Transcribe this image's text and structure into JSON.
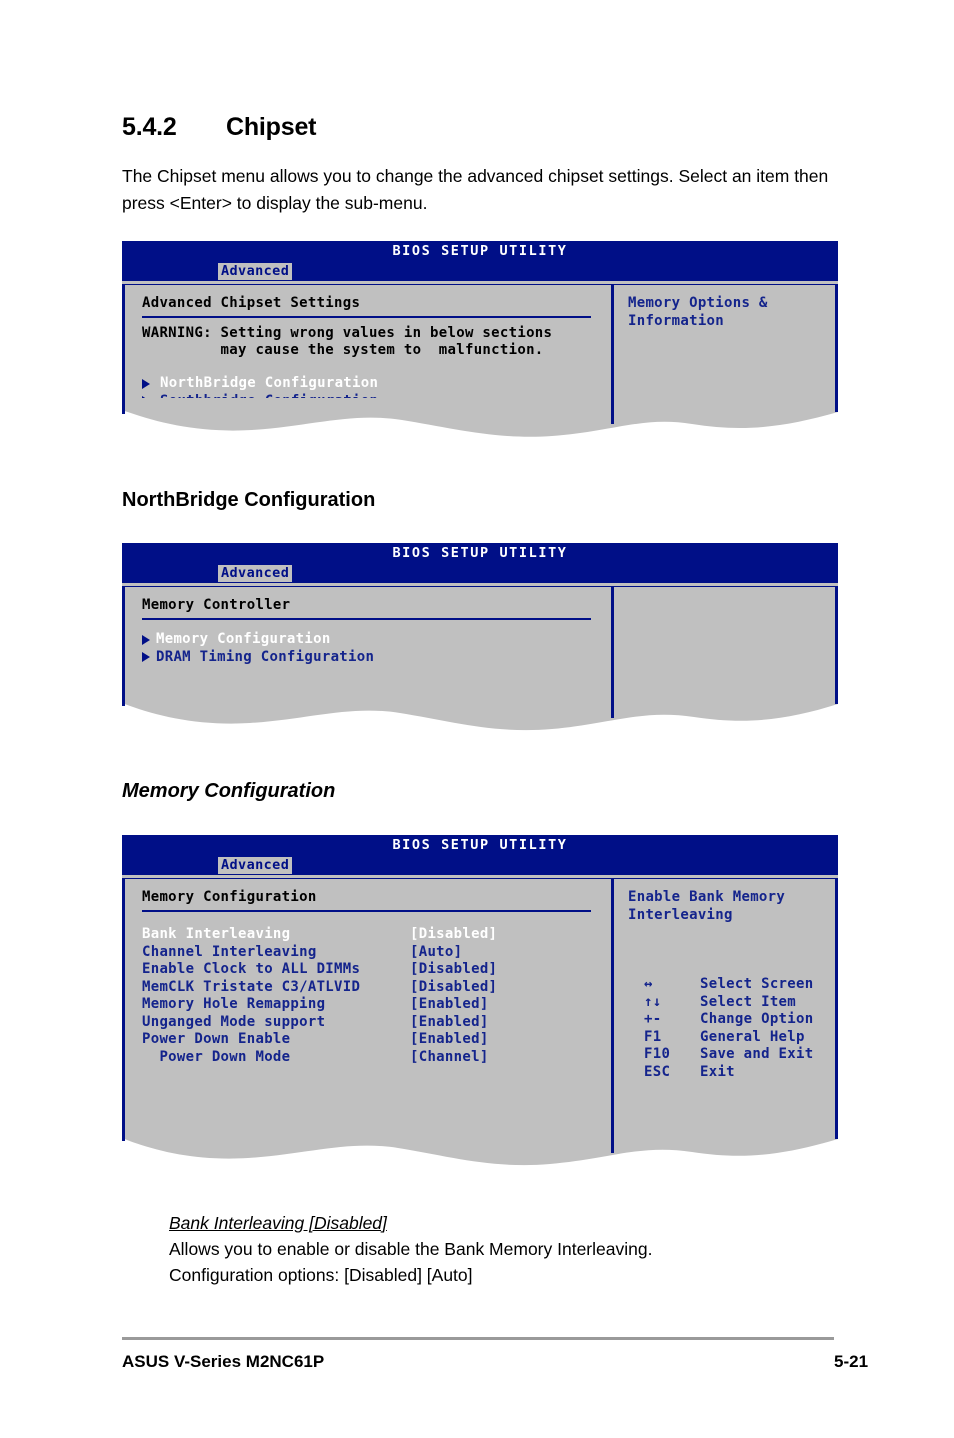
{
  "section": {
    "number": "5.4.2",
    "title": "Chipset",
    "intro": "The Chipset menu allows you to change the advanced chipset settings. Select an item then press <Enter> to display the sub-menu."
  },
  "subheadings": {
    "northbridge": "NorthBridge Configuration",
    "memory_configuration": "Memory Configuration"
  },
  "bios_common": {
    "title": "BIOS SETUP UTILITY",
    "tab": "Advanced"
  },
  "screen1": {
    "section_title": "Advanced Chipset Settings",
    "warning_line1": "WARNING: Setting wrong values in below sections",
    "warning_line2": "         may cause the system to  malfunction.",
    "menu": [
      {
        "label": "NorthBridge Configuration",
        "selected": true
      },
      {
        "label": "Southbridge Configuration",
        "selected": false
      }
    ],
    "help": "Memory Options &\nInformation"
  },
  "screen2": {
    "section_title": "Memory Controller",
    "menu": [
      {
        "label": "Memory Configuration",
        "selected": true
      },
      {
        "label": "DRAM Timing Configuration",
        "selected": false
      }
    ],
    "help": ""
  },
  "screen3": {
    "section_title": "Memory Configuration",
    "help": "Enable Bank Memory\nInterleaving",
    "options": [
      {
        "label": "Bank Interleaving",
        "value": "[Disabled]",
        "selected": true,
        "indent": false
      },
      {
        "label": "Channel Interleaving",
        "value": "[Auto]",
        "selected": false,
        "indent": false
      },
      {
        "label": "Enable Clock to ALL DIMMs",
        "value": "[Disabled]",
        "selected": false,
        "indent": false
      },
      {
        "label": "MemCLK Tristate C3/ATLVID",
        "value": "[Disabled]",
        "selected": false,
        "indent": false
      },
      {
        "label": "Memory Hole Remapping",
        "value": "[Enabled]",
        "selected": false,
        "indent": false
      },
      {
        "label": "Unganged Mode support",
        "value": "[Enabled]",
        "selected": false,
        "indent": false
      },
      {
        "label": "Power Down Enable",
        "value": "[Enabled]",
        "selected": false,
        "indent": false
      },
      {
        "label": "  Power Down Mode",
        "value": "[Channel]",
        "selected": false,
        "indent": true
      }
    ],
    "legend": [
      {
        "key": "↔",
        "action": "Select Screen"
      },
      {
        "key": "↑↓",
        "action": "Select Item"
      },
      {
        "key": "+-",
        "action": "Change Option"
      },
      {
        "key": "F1",
        "action": "General Help"
      },
      {
        "key": "F10",
        "action": "Save and Exit"
      },
      {
        "key": "ESC",
        "action": "Exit"
      }
    ]
  },
  "description": {
    "title": "Bank Interleaving [Disabled]",
    "line1": "Allows you to enable or disable the Bank Memory Interleaving.",
    "line2": "Configuration options: [Disabled] [Auto]"
  },
  "footer": {
    "left": "ASUS V-Series M2NC61P",
    "page": "5-21"
  },
  "colors": {
    "bios_navy": "#000f87",
    "bios_gray": "#c0c0c0",
    "bios_text_blue": "#14248c",
    "bios_selected": "#ffffff"
  }
}
